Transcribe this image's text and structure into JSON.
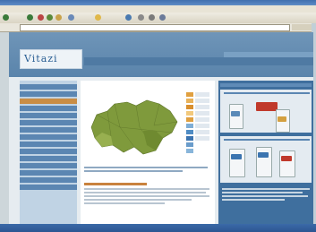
{
  "browser": {
    "menu": [
      "",
      "",
      "",
      "",
      "",
      ""
    ],
    "toolbar_labels": [
      "",
      "",
      ""
    ],
    "address_value": "",
    "status_text": ""
  },
  "site": {
    "logo": "Vitazi",
    "nav": [
      "",
      "",
      "",
      ""
    ],
    "nav_active_index": 1
  },
  "sidebar": {
    "items": [
      "",
      "",
      "",
      "",
      "",
      "",
      "",
      "",
      "",
      "",
      "",
      "",
      "",
      "",
      ""
    ]
  },
  "main": {
    "map_title": "",
    "legend_colors": [
      "#e0a040",
      "#e8b25a",
      "#d98f2e",
      "#f2c97c",
      "#e0a040",
      "#7faed6",
      "#4f8cc4",
      "#3b74b0",
      "#6a9ccb",
      "#88b5da"
    ]
  },
  "colors": {
    "brand": "#2b5f94",
    "map_land": "#7f9a3c",
    "nav_bg": "#4f7aa3",
    "accent": "#c9823d"
  }
}
